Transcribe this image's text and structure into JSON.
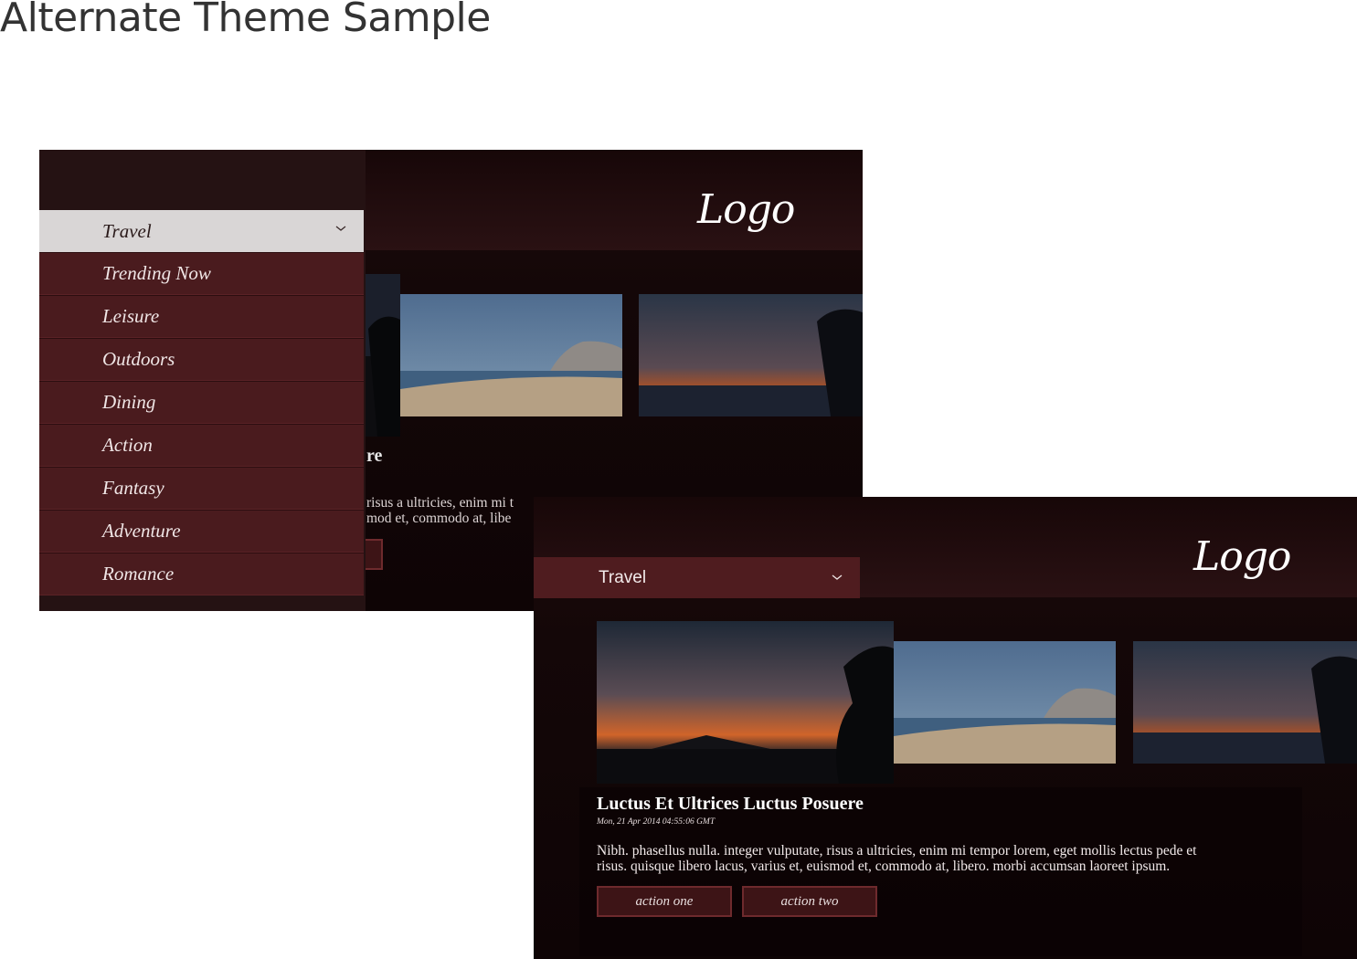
{
  "sheet": {
    "title": "Alternate Theme Sample"
  },
  "screen_menu": {
    "logo": "Logo",
    "dropdown": {
      "selected": "Travel"
    },
    "menu_items": [
      {
        "label": "Trending Now"
      },
      {
        "label": "Leisure"
      },
      {
        "label": "Outdoors"
      },
      {
        "label": "Dining"
      },
      {
        "label": "Action"
      },
      {
        "label": "Fantasy"
      },
      {
        "label": "Adventure"
      },
      {
        "label": "Romance"
      }
    ],
    "peek_title": "re",
    "peek_body_1": "risus a ultricies, enim mi t",
    "peek_body_2": "mod et, commodo at, libe"
  },
  "screen_main": {
    "logo": "Logo",
    "dropdown": {
      "selected": "Travel"
    },
    "article": {
      "title": "Luctus Et Ultrices Luctus Posuere",
      "date": "Mon, 21 Apr 2014 04:55:06 GMT",
      "body_1": "Nibh. phasellus nulla. integer vulputate, risus a ultricies, enim mi tempor lorem, eget mollis lectus pede et",
      "body_2": "risus. quisque libero lacus, varius et, euismod et, commodo at, libero. morbi accumsan laoreet ipsum."
    },
    "actions": {
      "one": "action one",
      "two": "action two"
    }
  },
  "colors": {
    "menu_item_bg": "#4a1b1e",
    "dropdown_selected_bg": "#d9d6d6",
    "action_border": "#6e2a2d"
  },
  "icons": [
    "chevron-down-icon"
  ]
}
